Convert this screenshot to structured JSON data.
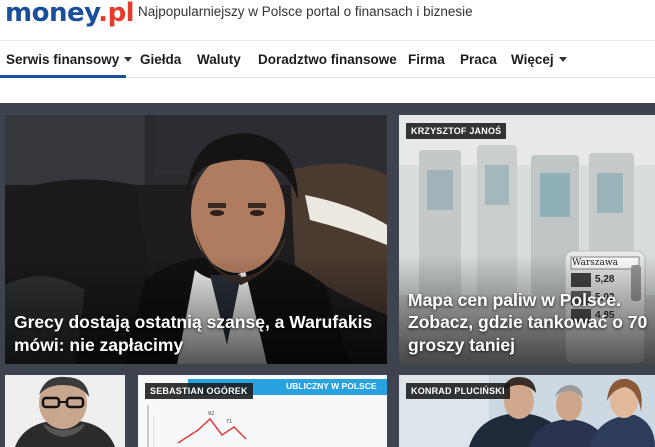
{
  "header": {
    "logo_main": "money",
    "logo_dot": ".",
    "logo_tld": "pl",
    "tagline": "Najpopularniejszy w Polsce portal o finansach i biznesie"
  },
  "nav": {
    "items": [
      {
        "label": "Serwis finansowy",
        "has_dropdown": true,
        "active": true
      },
      {
        "label": "Giełda"
      },
      {
        "label": "Waluty"
      },
      {
        "label": "Doradztwo finansowe"
      },
      {
        "label": "Firma"
      },
      {
        "label": "Praca"
      },
      {
        "label": "Więcej",
        "has_dropdown": true
      }
    ]
  },
  "tiles": {
    "main": {
      "headline": "Grecy dostają ostatnią szansę, a Warufakis mówi: nie zapłacimy"
    },
    "right": {
      "author": "KRZYSZTOF JANOŚ",
      "headline": "Mapa cen paliw w Polsce. Zobacz, gdzie tankować o 70 groszy taniej",
      "sign_city": "Warszawa",
      "sign_prices": [
        "5,28",
        "5,02",
        "4,85"
      ]
    },
    "bottom_2": {
      "author": "SEBASTIAN OGÓREK",
      "banner": "UBLICZNY W POLSCE"
    },
    "bottom_3": {
      "author": "KONRAD PLUCIŃSKI"
    }
  },
  "colors": {
    "brand_blue": "#1a4f9c",
    "brand_red": "#e63a2a",
    "stage": "#3d4450"
  }
}
